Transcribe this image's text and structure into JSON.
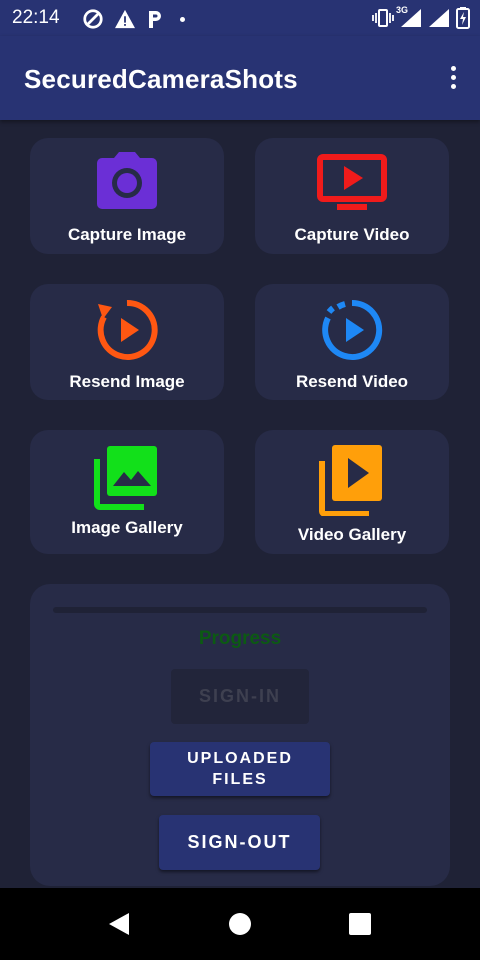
{
  "status_bar": {
    "time": "22:14",
    "network": "3G"
  },
  "app_bar": {
    "title": "SecuredCameraShots",
    "menu_icon": "more-vert-icon"
  },
  "tiles": [
    {
      "label": "Capture Image",
      "icon": "camera-icon",
      "color": "#6b2fd6"
    },
    {
      "label": "Capture Video",
      "icon": "tv-play-icon",
      "color": "#f01b1b"
    },
    {
      "label": "Resend Image",
      "icon": "replay-image-icon",
      "color": "#ff5712"
    },
    {
      "label": "Resend Video",
      "icon": "replay-video-icon",
      "color": "#1e88f5"
    },
    {
      "label": "Image Gallery",
      "icon": "photo-library-icon",
      "color": "#12e01a"
    },
    {
      "label": "Video Gallery",
      "icon": "video-library-icon",
      "color": "#ff9f0a"
    }
  ],
  "panel": {
    "progress_label": "Progress",
    "progress_value": 0,
    "sign_in_label": "SIGN-IN",
    "uploaded_files_label": "UPLOADED\nFILES",
    "sign_out_label": "SIGN-OUT"
  },
  "colors": {
    "app_bar": "#283373",
    "background": "#1f2236",
    "tile": "#272b47",
    "progress_text": "#0c5a13"
  }
}
